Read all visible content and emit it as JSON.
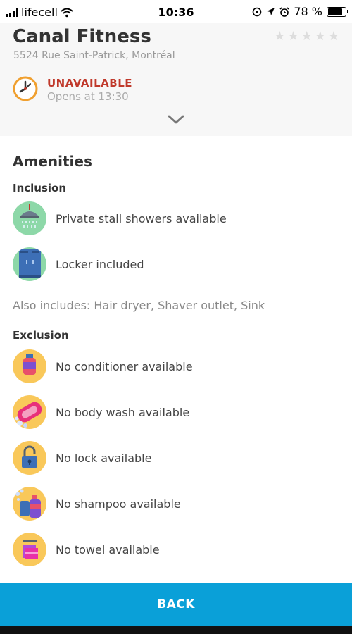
{
  "status_bar": {
    "carrier": "lifecell",
    "time": "10:36",
    "battery": "78 %",
    "battery_level": 0.78
  },
  "gym": {
    "name": "Canal Fitness",
    "address": "5524 Rue Saint-Patrick, Montréal",
    "rating_stars": 0,
    "status": "UNAVAILABLE",
    "opens": "Opens at 13:30"
  },
  "amenities": {
    "title": "Amenities",
    "inclusion_heading": "Inclusion",
    "inclusions": [
      {
        "label": "Private stall showers available",
        "icon": "shower-icon"
      },
      {
        "label": "Locker included",
        "icon": "locker-icon"
      }
    ],
    "also_includes": "Also includes: Hair dryer, Shaver outlet, Sink",
    "exclusion_heading": "Exclusion",
    "exclusions": [
      {
        "label": "No conditioner available",
        "icon": "conditioner-icon"
      },
      {
        "label": "No body wash available",
        "icon": "soap-icon"
      },
      {
        "label": "No lock available",
        "icon": "lock-icon"
      },
      {
        "label": "No shampoo available",
        "icon": "shampoo-icon"
      },
      {
        "label": "No towel available",
        "icon": "towel-icon"
      }
    ]
  },
  "back_button": "BACK",
  "colors": {
    "unavailable": "#c0392b",
    "accent": "#0aa0d8",
    "inclusion_icon_bg": "#8dd8a8",
    "exclusion_icon_bg": "#f9c85a"
  }
}
